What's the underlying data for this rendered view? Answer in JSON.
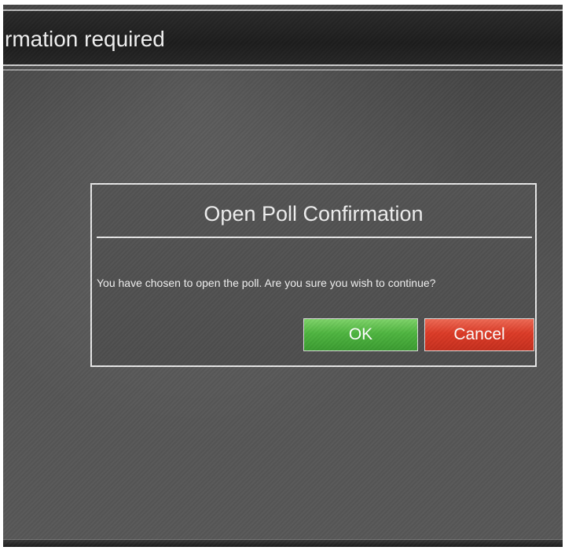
{
  "window": {
    "title": "rmation required"
  },
  "dialog": {
    "title": "Open Poll Confirmation",
    "message": "You have chosen to open the poll. Are you sure you wish to continue?",
    "buttons": {
      "ok_label": "OK",
      "cancel_label": "Cancel"
    }
  },
  "colors": {
    "ok_button": "#4fb640",
    "cancel_button": "#dd3b27",
    "background": "#555555",
    "text": "#f2f2f2"
  }
}
